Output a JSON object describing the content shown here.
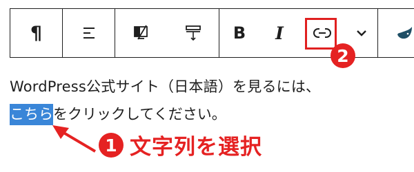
{
  "toolbar": {
    "items": [
      {
        "name": "paragraph",
        "glyph": "¶"
      },
      {
        "name": "align"
      },
      {
        "name": "media-text"
      },
      {
        "name": "vertical-align"
      },
      {
        "name": "bold",
        "glyph": "B"
      },
      {
        "name": "italic",
        "glyph": "I"
      },
      {
        "name": "link"
      },
      {
        "name": "more"
      },
      {
        "name": "plugin"
      }
    ]
  },
  "content": {
    "line1": "WordPress公式サイト（日本語）を見るには、",
    "line2_selected": "こちら",
    "line2_rest": "をクリックしてください。"
  },
  "annotations": {
    "step1_number": "1",
    "step1_label": "文字列を選択",
    "step2_number": "2"
  },
  "colors": {
    "accent_red": "#e52222",
    "selection_blue": "#3a86d8",
    "plugin_icon": "#1f4f66"
  }
}
